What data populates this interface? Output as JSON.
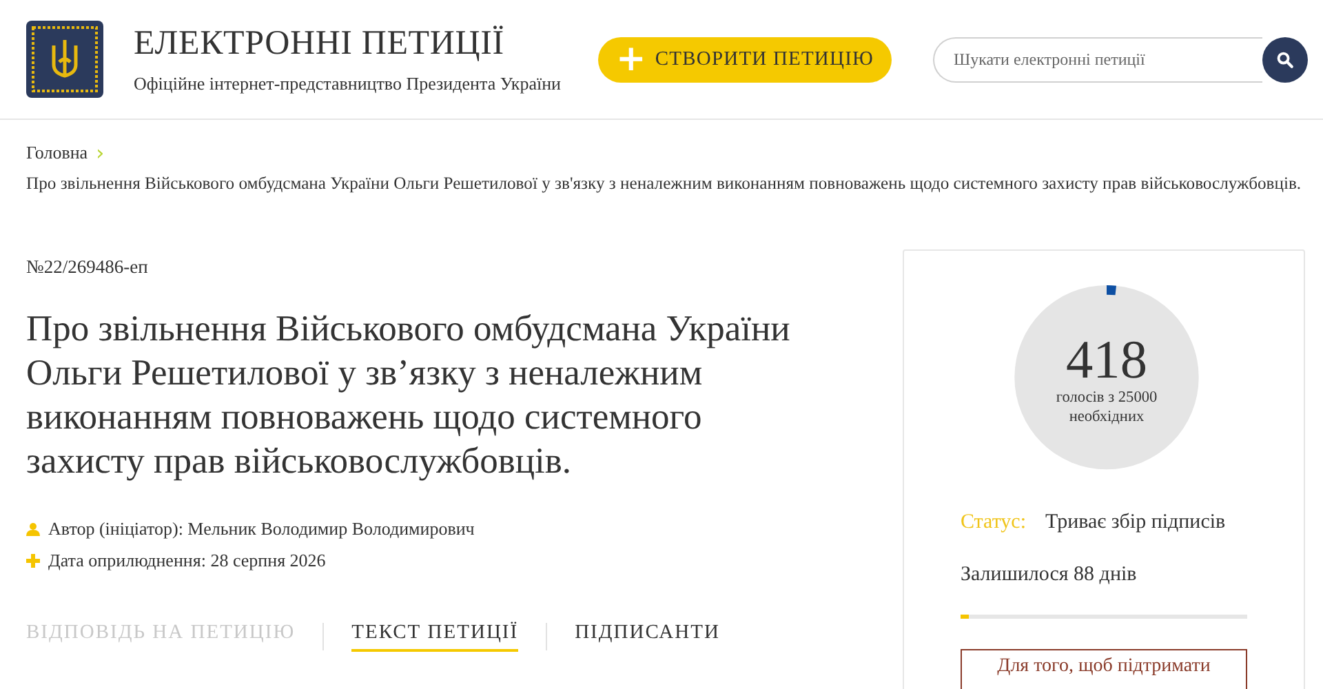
{
  "header": {
    "title": "ЕЛЕКТРОННІ ПЕТИЦІЇ",
    "subtitle": "Офіційне інтернет-представництво Президента України",
    "create_button": {
      "icon": "+",
      "label": "СТВОРИТИ ПЕТИЦІЮ"
    },
    "search": {
      "placeholder": "Шукати електронні петиції"
    }
  },
  "breadcrumb": {
    "items": [
      "Головна"
    ],
    "separator": "›",
    "current": "Про звільнення Військового омбудсмана України Ольги Решетилової у зв'язку з неналежним виконанням повноважень щодо системного захисту прав військовослужбовців."
  },
  "petition": {
    "number": "№22/269486-еп",
    "title": "Про звільнення Військового омбудсмана України Ольги Решетилової у зв’язку з неналежним виконанням повноважень щодо системного захисту прав військовослужбовців.",
    "meta": [
      {
        "kind": "author",
        "text": "Автор (ініціатор): Мельник Володимир Володимирович"
      },
      {
        "kind": "date",
        "text": "Дата оприлюднення: 28 серпня 2026"
      }
    ],
    "tabs": [
      {
        "label": "ВІДПОВІДЬ НА ПЕТИЦІЮ",
        "selected": false,
        "disabled": true
      },
      {
        "label": "ТЕКСТ ПЕТИЦІЇ",
        "selected": true,
        "disabled": false
      },
      {
        "label": "ПІДПИСАНТИ",
        "selected": false,
        "disabled": false
      }
    ]
  },
  "votes": {
    "count": "418",
    "caption": "голосів з 25000 необхідних",
    "level": 0.0167,
    "status_label": "Статус:",
    "status": "Триває збір підписів",
    "remaining": "Залишилося 88 днів",
    "time_bar": {
      "level": 0.03
    },
    "sign_note": "Для того, щоб підтримати"
  }
}
